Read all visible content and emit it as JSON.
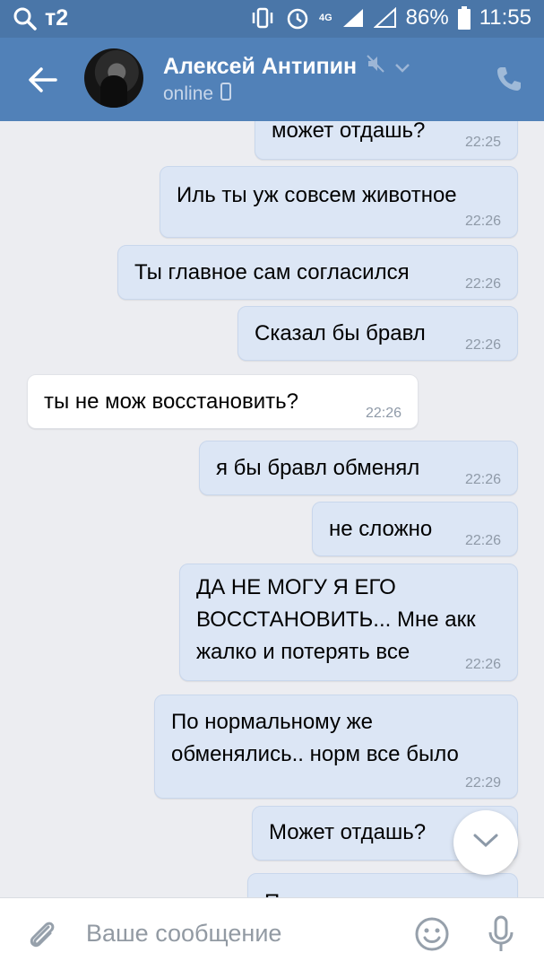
{
  "statusbar": {
    "carrier": "т2",
    "network": "4G",
    "battery": "86%",
    "time": "11:55"
  },
  "header": {
    "name": "Алексей Антипин",
    "status": "online"
  },
  "messages": [
    {
      "direction": "out",
      "text": "может отдашь?",
      "time": "22:25"
    },
    {
      "direction": "out",
      "text": "Иль ты уж совсем животное",
      "time": "22:26"
    },
    {
      "direction": "out",
      "text": "Ты главное сам согласился",
      "time": "22:26"
    },
    {
      "direction": "out",
      "text": "Сказал бы бравл",
      "time": "22:26"
    },
    {
      "direction": "in",
      "text": "ты не мож восстановить?",
      "time": "22:26"
    },
    {
      "direction": "out",
      "text": "я бы бравл обменял",
      "time": "22:26"
    },
    {
      "direction": "out",
      "text": "не сложно",
      "time": "22:26"
    },
    {
      "direction": "out",
      "lines": [
        "ДА НЕ МОГУ Я ЕГО",
        "ВОССТАНОВИТЬ... Мне акк",
        "жалко и потерять все"
      ],
      "time": "22:26"
    },
    {
      "direction": "out",
      "lines": [
        "По нормальному же",
        "обменялись.. норм все было"
      ],
      "time": "22:29"
    },
    {
      "direction": "out",
      "text": "Может отдашь?",
      "time": ""
    },
    {
      "direction": "out",
      "text": "П",
      "time": ""
    }
  ],
  "composer": {
    "placeholder": "Ваше сообщение"
  }
}
